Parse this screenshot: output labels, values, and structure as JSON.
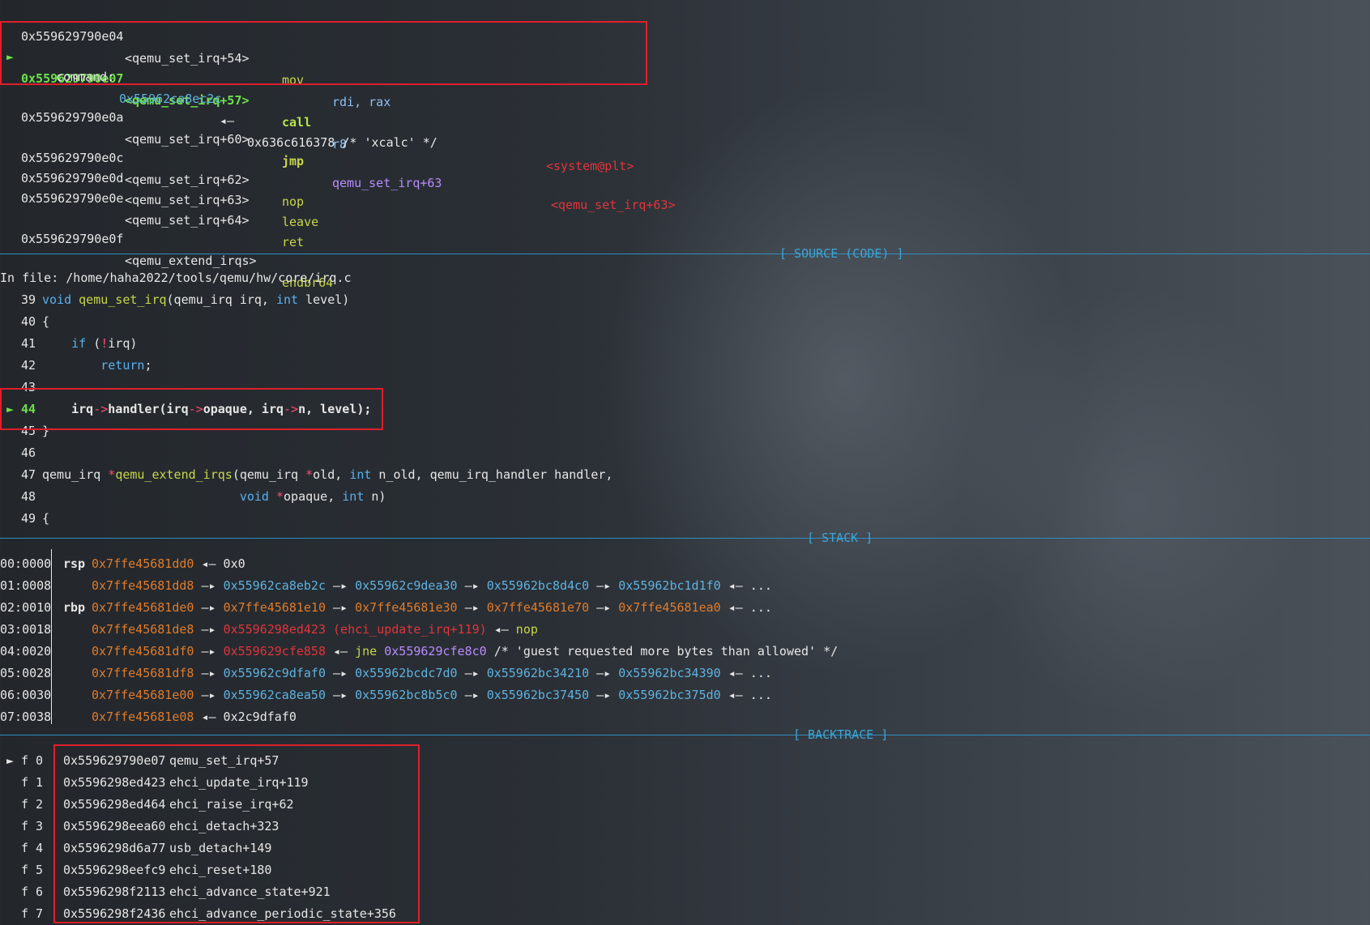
{
  "disasm": [
    {
      "addr": "0x559629790e04",
      "sym": "<qemu_set_irq+54>",
      "mnem": "mov",
      "ops": "rdi, rax",
      "note": ""
    },
    {
      "addr": "0x559629790e07",
      "sym": "<qemu_set_irq+57>",
      "mnem": "call",
      "ops": "r8",
      "note": "<system@plt>"
    },
    {
      "addr": "0x559629790e0a",
      "sym": "<qemu_set_irq+60>",
      "mnem": "jmp",
      "ops": "qemu_set_irq+63",
      "note": "<qemu_set_irq+63>"
    },
    {
      "addr": "0x559629790e0c",
      "sym": "<qemu_set_irq+62>",
      "mnem": "nop",
      "ops": "",
      "note": ""
    },
    {
      "addr": "0x559629790e0d",
      "sym": "<qemu_set_irq+63>",
      "mnem": "leave",
      "ops": "",
      "note": ""
    },
    {
      "addr": "0x559629790e0e",
      "sym": "<qemu_set_irq+64>",
      "mnem": "ret",
      "ops": "",
      "note": ""
    },
    {
      "addr": "0x559629790e0f",
      "sym": "<qemu_extend_irqs>",
      "mnem": "endbr64",
      "ops": "",
      "note": ""
    }
  ],
  "command": {
    "label": "command:",
    "ptr": "0x55962ca8ec2c",
    "arrow": "◂—",
    "val": "0x636c616378 /* 'xcalc' */"
  },
  "marker": "►",
  "source": {
    "header": "[ SOURCE (CODE) ]",
    "file": "In file: /home/haha2022/tools/qemu/hw/core/irq.c",
    "lines": [
      {
        "n": "39",
        "parts": [
          [
            "kw",
            "void "
          ],
          [
            "fn",
            "qemu_set_irq"
          ],
          [
            "",
            "(qemu_irq irq, "
          ],
          [
            "kw",
            "int"
          ],
          [
            "",
            " level)"
          ]
        ]
      },
      {
        "n": "40",
        "parts": [
          [
            "",
            "{"
          ]
        ]
      },
      {
        "n": "41",
        "parts": [
          [
            "",
            "    "
          ],
          [
            "kw",
            "if"
          ],
          [
            "",
            " ("
          ],
          [
            "pink",
            "!"
          ],
          [
            "",
            "irq)"
          ]
        ]
      },
      {
        "n": "42",
        "parts": [
          [
            "",
            "        "
          ],
          [
            "kw",
            "return"
          ],
          [
            "",
            ";"
          ]
        ]
      },
      {
        "n": "43",
        "parts": [
          [
            "",
            ""
          ]
        ]
      },
      {
        "n": "44",
        "parts": [
          [
            "bold",
            "    irq"
          ],
          [
            "pink",
            "->"
          ],
          [
            "bold",
            "handler(irq"
          ],
          [
            "pink",
            "->"
          ],
          [
            "bold",
            "opaque, irq"
          ],
          [
            "pink",
            "->"
          ],
          [
            "bold",
            "n, level);"
          ]
        ]
      },
      {
        "n": "45",
        "parts": [
          [
            "",
            "}"
          ]
        ]
      },
      {
        "n": "46",
        "parts": [
          [
            "",
            ""
          ]
        ]
      },
      {
        "n": "47",
        "parts": [
          [
            "",
            "qemu_irq "
          ],
          [
            "pink",
            "*"
          ],
          [
            "fn",
            "qemu_extend_irqs"
          ],
          [
            "",
            "(qemu_irq "
          ],
          [
            "pink",
            "*"
          ],
          [
            "",
            "old, "
          ],
          [
            "kw",
            "int"
          ],
          [
            "",
            " n_old, qemu_irq_handler handler,"
          ]
        ]
      },
      {
        "n": "48",
        "parts": [
          [
            "",
            "                           "
          ],
          [
            "kw",
            "void "
          ],
          [
            "pink",
            "*"
          ],
          [
            "",
            "opaque, "
          ],
          [
            "kw",
            "int"
          ],
          [
            "",
            " n)"
          ]
        ]
      },
      {
        "n": "49",
        "parts": [
          [
            "",
            "{"
          ]
        ]
      }
    ]
  },
  "stack": {
    "header": "[ STACK ]",
    "rows": [
      {
        "off": "00:0000",
        "reg": "rsp",
        "parts": [
          [
            "orange",
            "0x7ffe45681dd0"
          ],
          [
            "",
            " ◂— 0x0"
          ]
        ]
      },
      {
        "off": "01:0008",
        "reg": "",
        "parts": [
          [
            "orange",
            "0x7ffe45681dd8"
          ],
          [
            "",
            " —▸ "
          ],
          [
            "cyan",
            "0x55962ca8eb2c"
          ],
          [
            "",
            " —▸ "
          ],
          [
            "cyan",
            "0x55962c9dea30"
          ],
          [
            "",
            " —▸ "
          ],
          [
            "cyan",
            "0x55962bc8d4c0"
          ],
          [
            "",
            " —▸ "
          ],
          [
            "cyan",
            "0x55962bc1d1f0"
          ],
          [
            "",
            " ◂— ..."
          ]
        ]
      },
      {
        "off": "02:0010",
        "reg": "rbp",
        "parts": [
          [
            "orange",
            "0x7ffe45681de0"
          ],
          [
            "",
            " —▸ "
          ],
          [
            "orange",
            "0x7ffe45681e10"
          ],
          [
            "",
            " —▸ "
          ],
          [
            "orange",
            "0x7ffe45681e30"
          ],
          [
            "",
            " —▸ "
          ],
          [
            "orange",
            "0x7ffe45681e70"
          ],
          [
            "",
            " —▸ "
          ],
          [
            "orange",
            "0x7ffe45681ea0"
          ],
          [
            "",
            " ◂— ..."
          ]
        ]
      },
      {
        "off": "03:0018",
        "reg": "",
        "parts": [
          [
            "orange",
            "0x7ffe45681de8"
          ],
          [
            "",
            " —▸ "
          ],
          [
            "red",
            "0x5596298ed423 (ehci_update_irq+119)"
          ],
          [
            "",
            " ◂— "
          ],
          [
            "mnem-y",
            "nop"
          ]
        ]
      },
      {
        "off": "04:0020",
        "reg": "",
        "parts": [
          [
            "orange",
            "0x7ffe45681df0"
          ],
          [
            "",
            " —▸ "
          ],
          [
            "red",
            "0x559629cfe858"
          ],
          [
            "",
            " ◂— "
          ],
          [
            "mnem-y",
            "jne "
          ],
          [
            "mnem-p",
            "0x559629cfe8c0"
          ],
          [
            "",
            " /* 'guest requested more bytes than allowed' */"
          ]
        ]
      },
      {
        "off": "05:0028",
        "reg": "",
        "parts": [
          [
            "orange",
            "0x7ffe45681df8"
          ],
          [
            "",
            " —▸ "
          ],
          [
            "cyan",
            "0x55962c9dfaf0"
          ],
          [
            "",
            " —▸ "
          ],
          [
            "cyan",
            "0x55962bcdc7d0"
          ],
          [
            "",
            " —▸ "
          ],
          [
            "cyan",
            "0x55962bc34210"
          ],
          [
            "",
            " —▸ "
          ],
          [
            "cyan",
            "0x55962bc34390"
          ],
          [
            "",
            " ◂— ..."
          ]
        ]
      },
      {
        "off": "06:0030",
        "reg": "",
        "parts": [
          [
            "orange",
            "0x7ffe45681e00"
          ],
          [
            "",
            " —▸ "
          ],
          [
            "cyan",
            "0x55962ca8ea50"
          ],
          [
            "",
            " —▸ "
          ],
          [
            "cyan",
            "0x55962bc8b5c0"
          ],
          [
            "",
            " —▸ "
          ],
          [
            "cyan",
            "0x55962bc37450"
          ],
          [
            "",
            " —▸ "
          ],
          [
            "cyan",
            "0x55962bc375d0"
          ],
          [
            "",
            " ◂— ..."
          ]
        ]
      },
      {
        "off": "07:0038",
        "reg": "",
        "parts": [
          [
            "orange",
            "0x7ffe45681e08"
          ],
          [
            "",
            " ◂— 0x2c9dfaf0"
          ]
        ]
      }
    ]
  },
  "backtrace": {
    "header": "[ BACKTRACE ]",
    "frames": [
      {
        "f": "f 0",
        "addr": "0x559629790e07",
        "sym": "qemu_set_irq+57"
      },
      {
        "f": "f 1",
        "addr": "0x5596298ed423",
        "sym": "ehci_update_irq+119"
      },
      {
        "f": "f 2",
        "addr": "0x5596298ed464",
        "sym": "ehci_raise_irq+62"
      },
      {
        "f": "f 3",
        "addr": "0x5596298eea60",
        "sym": "ehci_detach+323"
      },
      {
        "f": "f 4",
        "addr": "0x5596298d6a77",
        "sym": "usb_detach+149"
      },
      {
        "f": "f 5",
        "addr": "0x5596298eefc9",
        "sym": "ehci_reset+180"
      },
      {
        "f": "f 6",
        "addr": "0x5596298f2113",
        "sym": "ehci_advance_state+921"
      },
      {
        "f": "f 7",
        "addr": "0x5596298f2436",
        "sym": "ehci_advance_periodic_state+356"
      }
    ]
  },
  "colors": {
    "border_highlight": "#e01e2a",
    "separator": "#2d8fc0",
    "current": "#6ee04a"
  }
}
